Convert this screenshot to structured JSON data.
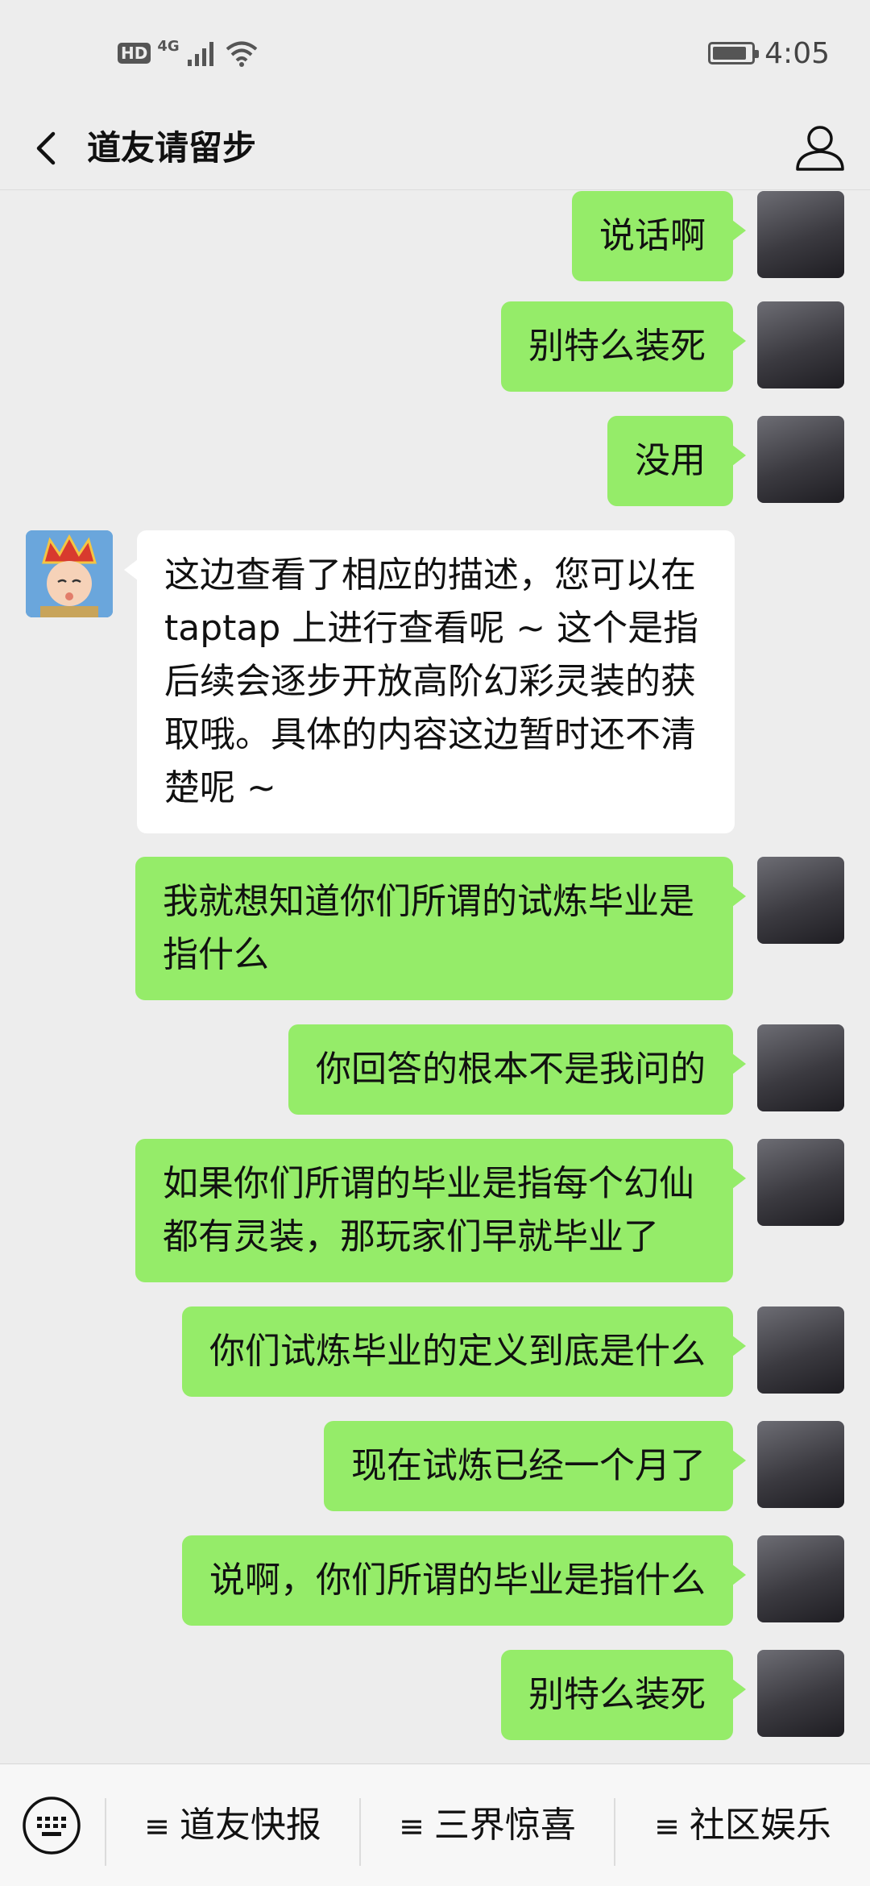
{
  "status_bar": {
    "hd": "HD",
    "network": "4G",
    "time": "4:05"
  },
  "header": {
    "title": "道友请留步",
    "back_icon": "chevron-left-icon",
    "profile_icon": "person-outline-icon"
  },
  "messages": [
    {
      "from": "me",
      "text": "说话啊"
    },
    {
      "from": "me",
      "text": "别特么装死"
    },
    {
      "from": "me",
      "text": "没用"
    },
    {
      "from": "bot",
      "text": "这边查看了相应的描述，您可以在taptap 上进行查看呢 ~ 这个是指后续会逐步开放高阶幻彩灵装的获取哦。具体的内容这边暂时还不清楚呢 ~"
    },
    {
      "from": "me",
      "text": "我就想知道你们所谓的试炼毕业是指什么"
    },
    {
      "from": "me",
      "text": "你回答的根本不是我问的"
    },
    {
      "from": "me",
      "text": "如果你们所谓的毕业是指每个幻仙都有灵装，那玩家们早就毕业了"
    },
    {
      "from": "me",
      "text": "你们试炼毕业的定义到底是什么"
    },
    {
      "from": "me",
      "text": "现在试炼已经一个月了"
    },
    {
      "from": "me",
      "text": "说啊，你们所谓的毕业是指什么"
    },
    {
      "from": "me",
      "text": "别特么装死"
    }
  ],
  "bottom_menu": {
    "keyboard_icon": "keyboard-icon",
    "items": [
      {
        "label": "道友快报"
      },
      {
        "label": "三界惊喜"
      },
      {
        "label": "社区娱乐"
      }
    ]
  },
  "colors": {
    "background": "#ededed",
    "my_bubble": "#95ec69",
    "their_bubble": "#ffffff"
  }
}
